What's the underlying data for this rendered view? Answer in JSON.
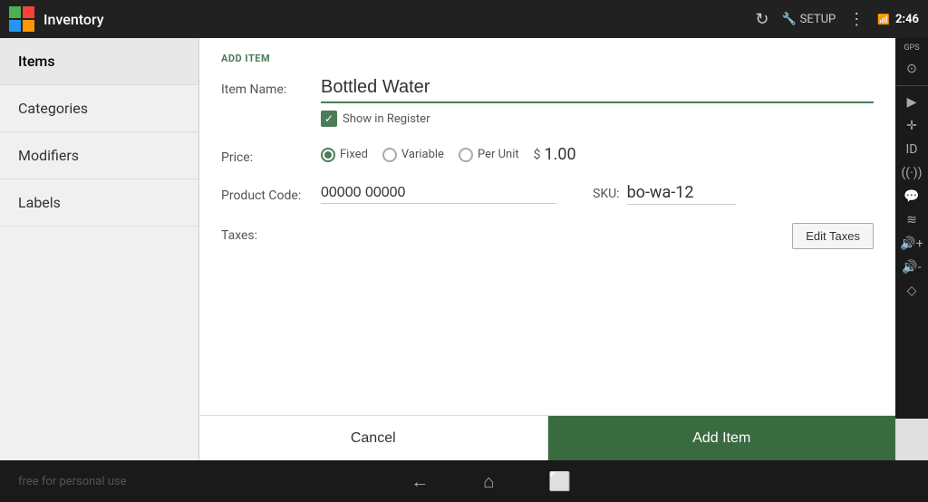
{
  "topBar": {
    "title": "Inventory",
    "time": "2:46",
    "setupLabel": "SETUP"
  },
  "sidebar": {
    "items": [
      {
        "label": "Items",
        "active": true
      },
      {
        "label": "Categories",
        "active": false
      },
      {
        "label": "Modifiers",
        "active": false
      },
      {
        "label": "Labels",
        "active": false
      }
    ]
  },
  "form": {
    "sectionTitle": "ADD ITEM",
    "itemNameLabel": "Item Name:",
    "itemNameValue": "Bottled Water",
    "showInRegisterLabel": "Show in Register",
    "priceLabel": "Price:",
    "priceOptions": [
      "Fixed",
      "Variable",
      "Per Unit"
    ],
    "priceSelectedIndex": 0,
    "priceDollarSign": "$",
    "priceAmount": "1.00",
    "productCodeLabel": "Product Code:",
    "productCodeValue": "00000 00000",
    "skuLabel": "SKU:",
    "skuValue": "bo-wa-12",
    "taxesLabel": "Taxes:",
    "editTaxesLabel": "Edit Taxes"
  },
  "buttons": {
    "cancelLabel": "Cancel",
    "addItemLabel": "Add Item"
  },
  "bottomBar": {
    "freeText": "free for personal use"
  },
  "rightPanel": {
    "gpsLabel": "GPS"
  }
}
